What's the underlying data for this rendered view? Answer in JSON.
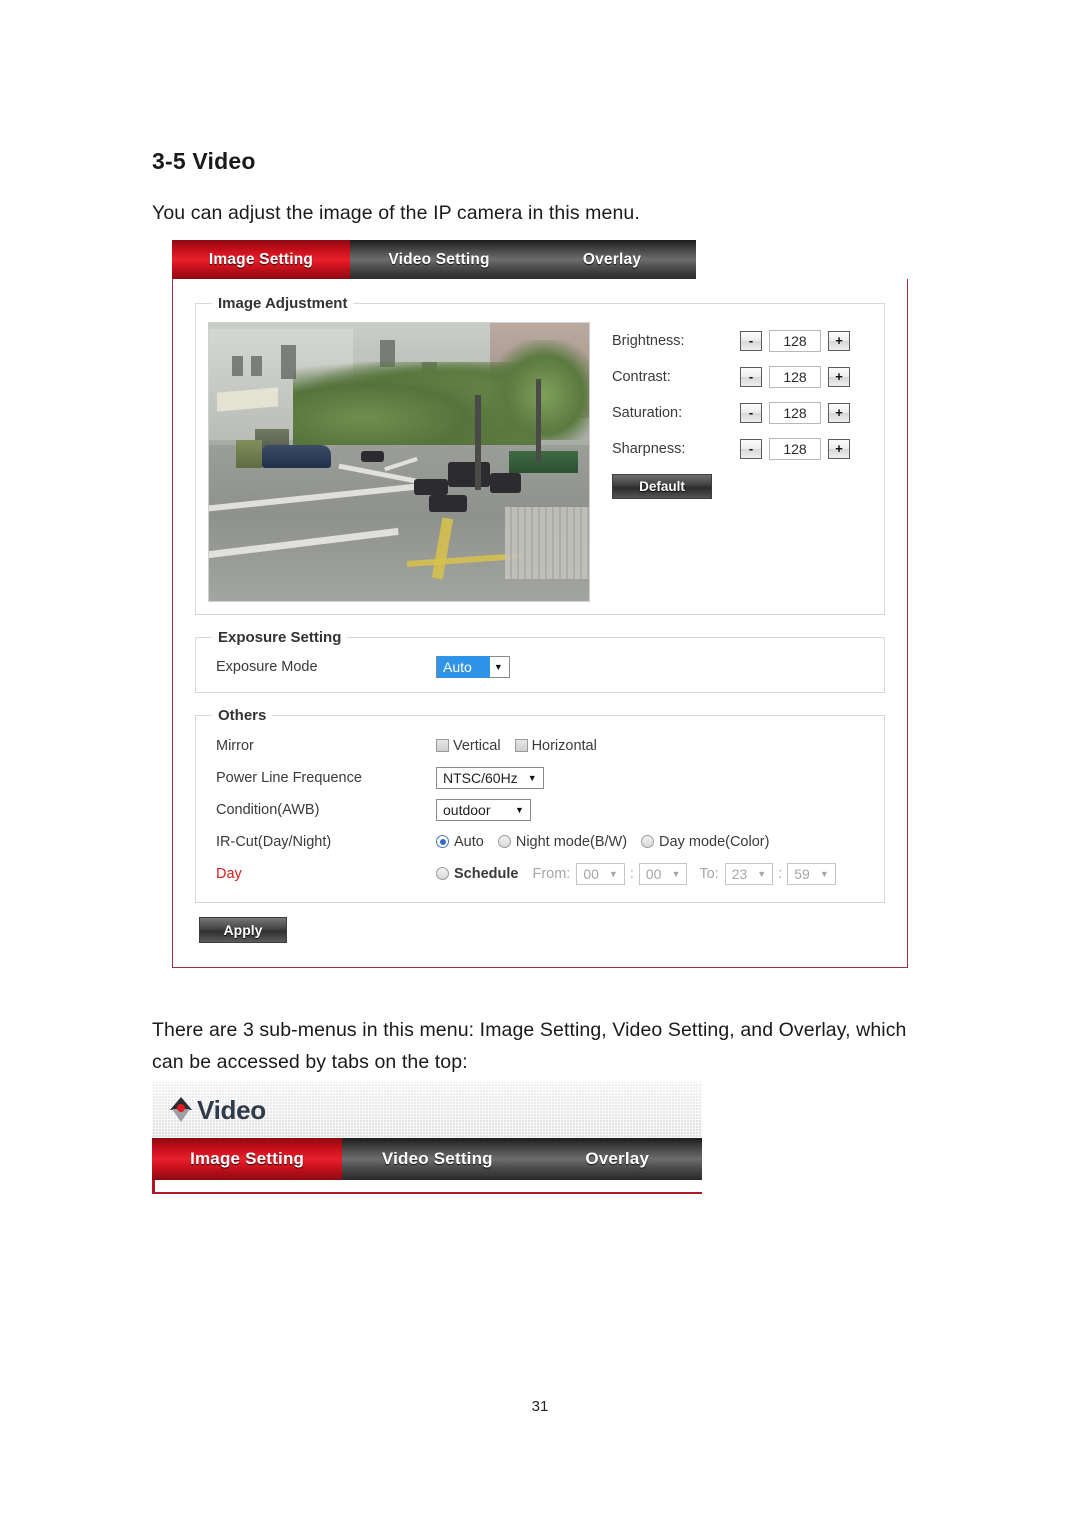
{
  "document": {
    "heading": "3-5 Video",
    "intro": "You can adjust the image of the IP camera in this menu.",
    "sub_paragraph": "There are 3 sub-menus in this menu: Image Setting, Video Setting, and Overlay, which can be accessed by tabs on the top:",
    "page_number": "31"
  },
  "colors": {
    "active_tab_red": "#c00d18",
    "panel_border": "#9c3040",
    "selection_blue": "#2f93e8",
    "day_label_red": "#d0211f",
    "logo_dot_red": "#e01b20"
  },
  "screenshot_top": {
    "tabs": [
      {
        "label": "Image Setting",
        "active": true
      },
      {
        "label": "Video Setting",
        "active": false
      },
      {
        "label": "Overlay",
        "active": false
      }
    ],
    "image_adjustment": {
      "legend": "Image Adjustment",
      "preview_alt": "live-camera-street-view",
      "controls": [
        {
          "label": "Brightness:",
          "value": "128",
          "minus": "-",
          "plus": "+"
        },
        {
          "label": "Contrast:",
          "value": "128",
          "minus": "-",
          "plus": "+"
        },
        {
          "label": "Saturation:",
          "value": "128",
          "minus": "-",
          "plus": "+"
        },
        {
          "label": "Sharpness:",
          "value": "128",
          "minus": "-",
          "plus": "+"
        }
      ],
      "default_button": "Default"
    },
    "exposure_setting": {
      "legend": "Exposure Setting",
      "mode_label": "Exposure Mode",
      "mode_value": "Auto"
    },
    "others": {
      "legend": "Others",
      "mirror_label": "Mirror",
      "mirror_vertical": "Vertical",
      "mirror_horizontal": "Horizontal",
      "power_line_label": "Power Line Frequence",
      "power_line_value": "NTSC/60Hz",
      "condition_label": "Condition(AWB)",
      "condition_value": "outdoor",
      "ircut_label": "IR-Cut(Day/Night)",
      "ircut_auto": "Auto",
      "ircut_night": "Night mode(B/W)",
      "ircut_day": "Day mode(Color)",
      "day_label": "Day",
      "schedule_label": "Schedule",
      "from_label": "From:",
      "from_hour": "00",
      "from_minute": "00",
      "to_label": "To:",
      "to_hour": "23",
      "to_minute": "59",
      "colon": ":"
    },
    "apply_button": "Apply"
  },
  "screenshot_bottom": {
    "logo_text": "Video",
    "tabs": [
      {
        "label": "Image Setting",
        "active": true
      },
      {
        "label": "Video Setting",
        "active": false
      },
      {
        "label": "Overlay",
        "active": false
      }
    ]
  }
}
